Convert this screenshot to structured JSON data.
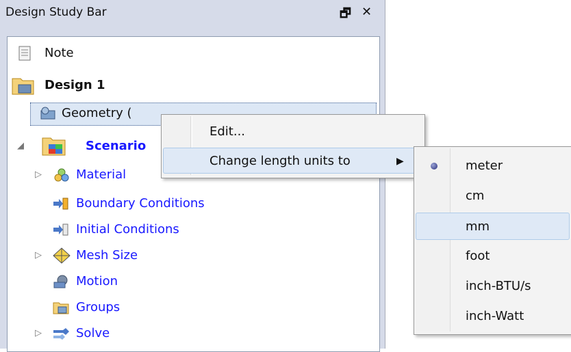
{
  "panel": {
    "title": "Design Study Bar",
    "pin_glyph": "🗗",
    "close_glyph": "✕"
  },
  "tree": {
    "note": "Note",
    "design": "Design 1",
    "geometry": "Geometry (",
    "scenario": "Scenario",
    "material": "Material",
    "boundary": "Boundary Conditions",
    "initial": "Initial Conditions",
    "mesh": "Mesh Size",
    "motion": "Motion",
    "groups": "Groups",
    "solve": "Solve"
  },
  "context_menu": {
    "edit": "Edit...",
    "change_units": "Change length units to",
    "submenu_arrow": "▶"
  },
  "units_submenu": {
    "items": [
      "meter",
      "cm",
      "mm",
      "foot",
      "inch-BTU/s",
      "inch-Watt"
    ],
    "selected": "meter",
    "hovered": "mm"
  },
  "colors": {
    "link_blue": "#1919ff",
    "panel_bg": "#d6dbe9",
    "menu_highlight": "#dfe9f6"
  },
  "icons": {
    "note": "note-icon",
    "design": "design-folder-icon",
    "geometry": "geometry-icon",
    "scenario": "scenario-folder-icon",
    "material": "material-icon",
    "boundary": "boundary-conditions-icon",
    "initial": "initial-conditions-icon",
    "mesh": "mesh-size-icon",
    "motion": "motion-icon",
    "groups": "groups-icon",
    "solve": "solve-icon"
  }
}
